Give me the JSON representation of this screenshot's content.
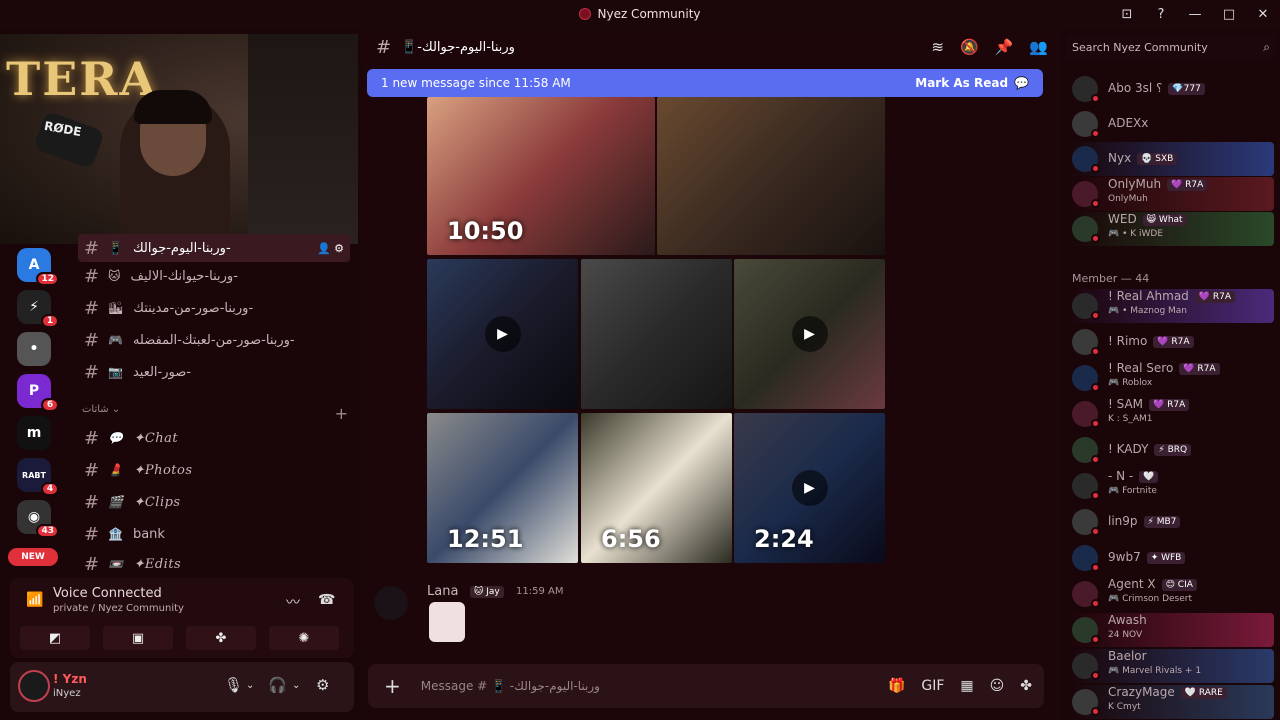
{
  "window": {
    "title": "Nyez Community",
    "controls": [
      "inbox-icon",
      "help-icon",
      "minimize",
      "maximize",
      "close"
    ]
  },
  "webcam": {
    "sign_text": "TERA",
    "mic_brand": "RØDE"
  },
  "guilds": [
    {
      "name": "guild-1",
      "badge": "12",
      "color": "#2a7ae2",
      "glyph": "A"
    },
    {
      "name": "guild-2",
      "badge": "1",
      "color": "#222",
      "glyph": "⚡"
    },
    {
      "name": "guild-3",
      "badge": "",
      "color": "#555",
      "glyph": "•"
    },
    {
      "name": "guild-4",
      "badge": "6",
      "color": "#7a2ad0",
      "glyph": "P"
    },
    {
      "name": "guild-5",
      "badge": "",
      "color": "#111",
      "glyph": "m"
    },
    {
      "name": "guild-6",
      "badge": "4",
      "color": "#1a1a3a",
      "glyph": "RABT"
    },
    {
      "name": "guild-7",
      "badge": "43",
      "color": "#333",
      "glyph": "◉"
    }
  ],
  "new_badge": "NEW",
  "channels": [
    {
      "name": "وربنا-اليوم-جوالك-",
      "icon": "📱",
      "active": true
    },
    {
      "name": "وربنا-حيوانك-الاليف-",
      "icon": "🐱",
      "active": false
    },
    {
      "name": "وربنا-صور-من-مدينتك-",
      "icon": "🏙",
      "active": false
    },
    {
      "name": "وربنا-صور-من-لعبتك-المفضله-",
      "icon": "🎮",
      "active": false
    },
    {
      "name": "صور-العيد-",
      "icon": "📷",
      "active": false
    }
  ],
  "category": {
    "label": "شاتات"
  },
  "channels2": [
    {
      "name": "✦Chat",
      "icon": "💬"
    },
    {
      "name": "✦Photos",
      "icon": "💄"
    },
    {
      "name": "✦Clips",
      "icon": "🎬"
    },
    {
      "name": "bank",
      "icon": "🏦"
    },
    {
      "name": "✦Edits",
      "icon": "📼"
    }
  ],
  "voice": {
    "title": "Voice Connected",
    "subtitle": "private / Nyez Community"
  },
  "user": {
    "name": "! Yzn",
    "status": "iNyez"
  },
  "header": {
    "channel": "📱-وربنا-اليوم-جوالك"
  },
  "banner": {
    "text": "1 new message since 11:58 AM",
    "action": "Mark As Read"
  },
  "tiles": [
    {
      "clock": "10:50",
      "play": false,
      "bg": "linear-gradient(135deg,#d8a080,#8a3a3a,#2a1a1a)"
    },
    {
      "clock": "",
      "play": false,
      "bg": "linear-gradient(135deg,#6a4a30,#3a2a20,#1a1210)"
    },
    {
      "clock": "",
      "play": true,
      "bg": "linear-gradient(135deg,#2a3a5a,#1a1a2a,#0a0a10)"
    },
    {
      "clock": "",
      "play": false,
      "bg": "linear-gradient(135deg,#4a4a4a,#2a2a2a,#151515)"
    },
    {
      "clock": "",
      "play": true,
      "bg": "linear-gradient(135deg,#4a4a3a,#2a2a20,#6a3a40)"
    },
    {
      "clock": "12:51",
      "play": false,
      "bg": "linear-gradient(135deg,#8a8a8a,#3a4a6a,#e0e0d8)"
    },
    {
      "clock": "6:56",
      "play": false,
      "bg": "linear-gradient(135deg,#3a3a2a,#e8e0d0,#2a2a20)"
    },
    {
      "clock": "2:24",
      "play": true,
      "bg": "linear-gradient(135deg,#3a3a4a,#1a2a4a,#0a0a1a)"
    }
  ],
  "message": {
    "author": "Lana",
    "tag": "🐱 Jay",
    "time": "11:59 AM"
  },
  "composer": {
    "placeholder": "Message # 📱 -وربنا-اليوم-جوالك"
  },
  "search": {
    "placeholder": "Search Nyez Community"
  },
  "members_top": [
    {
      "name": "Abo 3sl ؟",
      "badge": "💎777",
      "activity": ""
    },
    {
      "name": "ADEXx",
      "badge": "",
      "activity": ""
    },
    {
      "name": "Nyx",
      "badge": "💀 SXB",
      "activity": ""
    },
    {
      "name": "OnlyMuh",
      "badge": "💜 R7A",
      "activity": "OnlyMuh"
    },
    {
      "name": "WED",
      "badge": "😸 What",
      "activity": "🎮 • K iWDE"
    }
  ],
  "members_header": "Member — 44",
  "members": [
    {
      "name": "! Real Ahmad",
      "badge": "💜 R7A",
      "activity": "🎮 • Maznog Man"
    },
    {
      "name": "! Rimo",
      "badge": "💜 R7A",
      "activity": ""
    },
    {
      "name": "! Real Sero",
      "badge": "💜 R7A",
      "activity": "🎮 Roblox"
    },
    {
      "name": "! SAM",
      "badge": "💜 R7A",
      "activity": "K : S_AM1"
    },
    {
      "name": "! KADY",
      "badge": "⚡ BRQ",
      "activity": ""
    },
    {
      "name": "- N -",
      "badge": "🤍",
      "activity": "🎮 Fortnite"
    },
    {
      "name": "lin9p",
      "badge": "⚡ MB7",
      "activity": ""
    },
    {
      "name": "9wb7",
      "badge": "✦ WFB",
      "activity": ""
    },
    {
      "name": "Agent X",
      "badge": "😊 CIA",
      "activity": "🎮 Crimson Desert"
    },
    {
      "name": "Awash",
      "badge": "",
      "activity": "24 NOV"
    },
    {
      "name": "Baelor",
      "badge": "",
      "activity": "🎮 Marvel Rivals + 1"
    },
    {
      "name": "CrazyMage",
      "badge": "🤍 RARE",
      "activity": "K Cmyt"
    }
  ]
}
